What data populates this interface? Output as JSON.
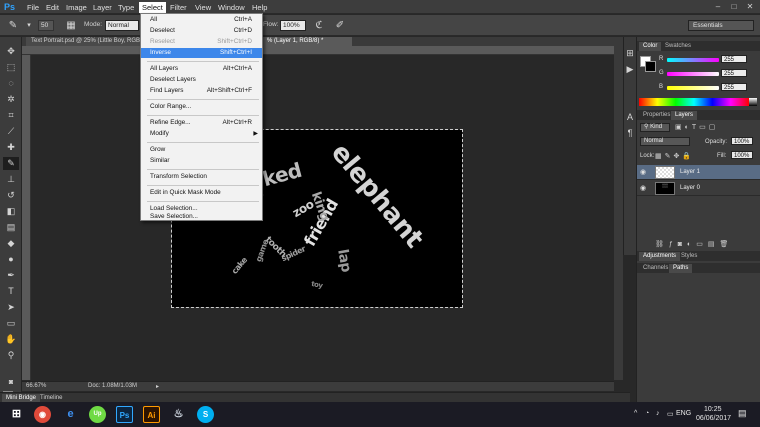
{
  "app": {
    "logo": "Ps"
  },
  "menubar": {
    "items": [
      "File",
      "Edit",
      "Image",
      "Layer",
      "Type",
      "Select",
      "Filter",
      "View",
      "Window",
      "Help"
    ],
    "window_controls": [
      "–",
      "□",
      "✕"
    ]
  },
  "options_bar": {
    "mode_label": "Mode:",
    "mode_value": "Normal",
    "brush_size": "50",
    "flow_label": "Flow:",
    "flow_value": "100%",
    "workspace": "Essentials"
  },
  "documents": {
    "tab1": "Text Portrait.psd @ 25% (Little Boy, RGB/8) *",
    "tab2": "% (Layer 1, RGB/8) *"
  },
  "select_menu": {
    "items": [
      {
        "label": "All",
        "shortcut": "Ctrl+A",
        "state": "normal"
      },
      {
        "label": "Deselect",
        "shortcut": "Ctrl+D",
        "state": "normal"
      },
      {
        "label": "Reselect",
        "shortcut": "Shift+Ctrl+D",
        "state": "disabled"
      },
      {
        "label": "Inverse",
        "shortcut": "Shift+Ctrl+I",
        "state": "highlighted"
      },
      {
        "label": "All Layers",
        "shortcut": "Alt+Ctrl+A",
        "state": "normal"
      },
      {
        "label": "Deselect Layers",
        "shortcut": "",
        "state": "normal"
      },
      {
        "label": "Find Layers",
        "shortcut": "Alt+Shift+Ctrl+F",
        "state": "normal"
      },
      {
        "label": "Color Range...",
        "shortcut": "",
        "state": "normal"
      },
      {
        "label": "Refine Edge...",
        "shortcut": "Alt+Ctrl+R",
        "state": "normal"
      },
      {
        "label": "Modify",
        "shortcut": "",
        "state": "submenu"
      },
      {
        "label": "Grow",
        "shortcut": "",
        "state": "normal"
      },
      {
        "label": "Similar",
        "shortcut": "",
        "state": "normal"
      },
      {
        "label": "Transform Selection",
        "shortcut": "",
        "state": "normal"
      },
      {
        "label": "Edit in Quick Mask Mode",
        "shortcut": "",
        "state": "normal"
      },
      {
        "label": "Load Selection...",
        "shortcut": "",
        "state": "normal"
      },
      {
        "label": "Save Selection...",
        "shortcut": "",
        "state": "normal"
      }
    ]
  },
  "canvas_words": [
    {
      "text": "elephant",
      "size": 26
    },
    {
      "text": "ked",
      "size": 20
    },
    {
      "text": "friend",
      "size": 16
    },
    {
      "text": "lap",
      "size": 14
    },
    {
      "text": "king",
      "size": 13
    },
    {
      "text": "zoo",
      "size": 12
    },
    {
      "text": "frog",
      "size": 11
    },
    {
      "text": "tooth",
      "size": 9
    },
    {
      "text": "spider",
      "size": 8
    },
    {
      "text": "cake",
      "size": 8
    },
    {
      "text": "game",
      "size": 8
    },
    {
      "text": "toy",
      "size": 7
    }
  ],
  "status": {
    "zoom": "66.67%",
    "doc": "Doc: 1.08M/1.03M"
  },
  "bottom_tabs": [
    "Mini Bridge",
    "Timeline"
  ],
  "color_panel": {
    "tabs": [
      "Color",
      "Swatches"
    ],
    "r_label": "R",
    "r_value": "255",
    "g_label": "G",
    "g_value": "255",
    "b_label": "B",
    "b_value": "255",
    "fg_color": "#ffffff",
    "bg_color": "#000000"
  },
  "properties_tabs": [
    "Properties",
    "Layers"
  ],
  "layers_panel": {
    "kind_filter": "Kind",
    "blend_mode": "Normal",
    "opacity_label": "Opacity:",
    "opacity_value": "100%",
    "lock_label": "Lock:",
    "fill_label": "Fill:",
    "fill_value": "100%",
    "layers": [
      {
        "name": "Layer 1",
        "selected": true
      },
      {
        "name": "Layer 0",
        "selected": false
      }
    ]
  },
  "adjustments_tabs": [
    "Adjustments",
    "Styles"
  ],
  "channels_tabs": [
    "Channels",
    "Paths"
  ],
  "taskbar": {
    "apps": [
      "Chrome",
      "Edge",
      "Upwork",
      "Ps",
      "Ai",
      "Steam",
      "Skype"
    ],
    "lang": "ENG",
    "time": "10:25",
    "date": "06/06/2017"
  }
}
